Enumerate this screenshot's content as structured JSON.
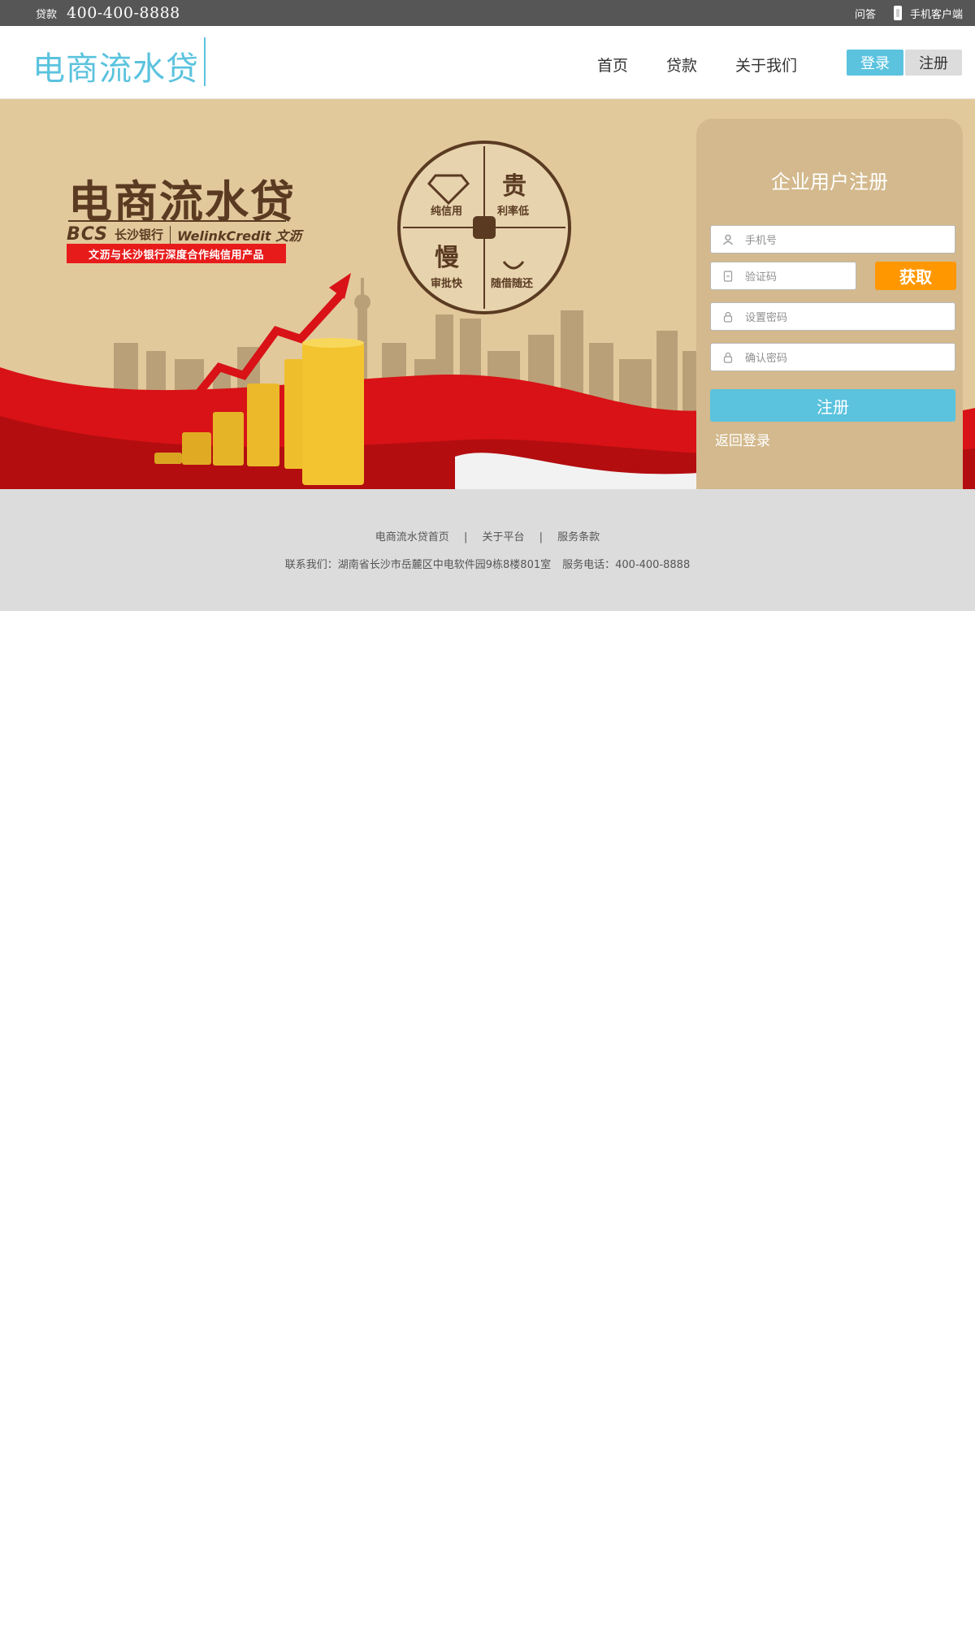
{
  "topbar": {
    "hotline_label": "贷款",
    "hotline_number": "400-400-8888",
    "qa_label": "问答",
    "mobile_client_label": "手机客户端"
  },
  "header": {
    "logo_text": "电商流水贷",
    "nav": [
      "首页",
      "贷款",
      "关于我们"
    ],
    "login_label": "登录",
    "register_label": "注册"
  },
  "banner": {
    "brand_title": "电商流水贷",
    "bank_mark": "BCS",
    "bank_name": "长沙银行",
    "partner_name": "WelinkCredit 文沥",
    "ribbon_text": "文沥与长沙银行深度合作纯信用产品",
    "quadrants": [
      {
        "icon": "diamond-icon",
        "label": "纯信用"
      },
      {
        "icon_char": "贵",
        "label": "利率低"
      },
      {
        "icon_char": "慢",
        "label": "审批快"
      },
      {
        "icon": "money-hand-icon",
        "label": "随借随还"
      }
    ]
  },
  "register_panel": {
    "title": "企业用户注册",
    "phone_placeholder": "手机号",
    "code_placeholder": "验证码",
    "get_code_label": "获取",
    "password_placeholder": "设置密码",
    "confirm_placeholder": "确认密码",
    "submit_label": "注册",
    "back_login_label": "返回登录"
  },
  "footer": {
    "links": [
      "电商流水贷首页",
      "关于平台",
      "服务条款"
    ],
    "separator": "|",
    "contact": "联系我们：湖南省长沙市岳麓区中电软件园9栋8楼801室",
    "service_phone": "服务电话：400-400-8888"
  },
  "colors": {
    "accent": "#5bc3de",
    "topbar_bg": "#565656",
    "banner_bg": "#e2c99c",
    "panel_bg": "#d3b98d",
    "get_code_bg": "#ff9800",
    "ribbon_red": "#e81b1b",
    "footer_bg": "#dcdcdc"
  }
}
